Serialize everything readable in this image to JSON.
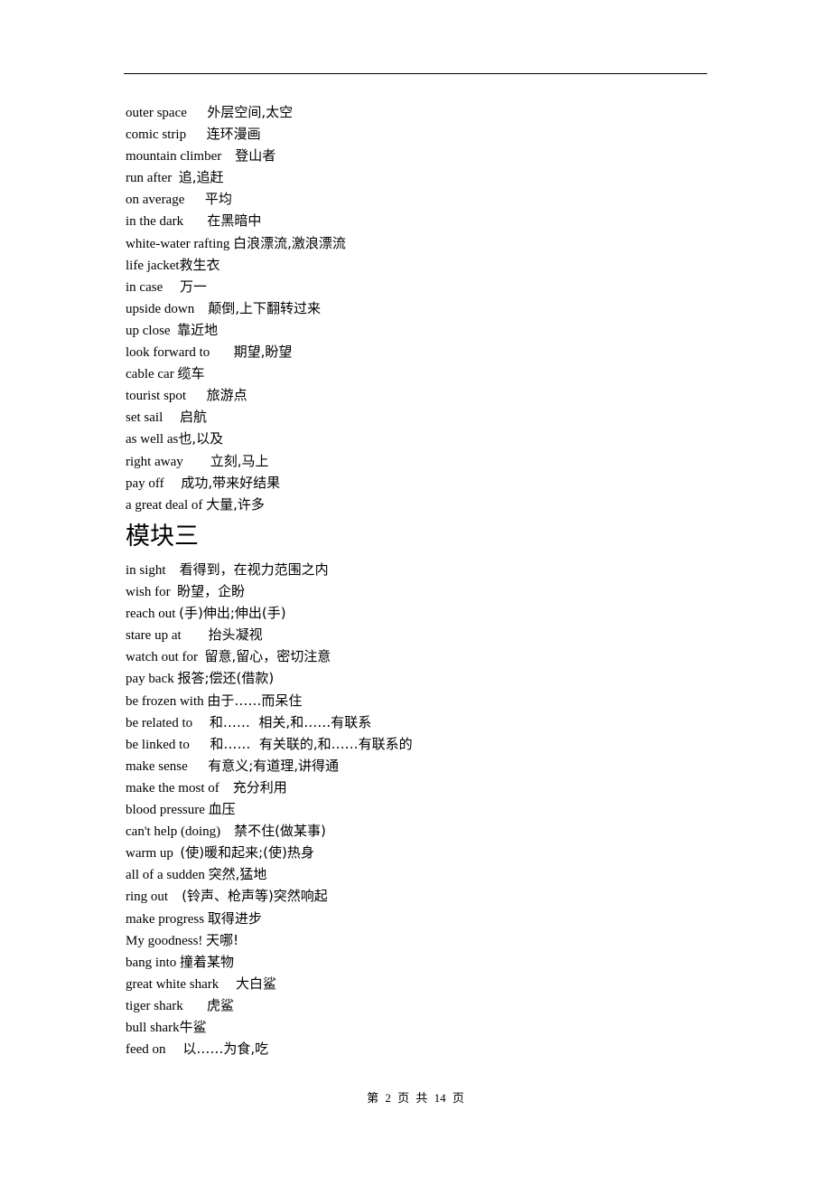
{
  "section_a": {
    "entries": [
      {
        "en": "outer space",
        "gap": "      ",
        "zh": "外层空间,太空"
      },
      {
        "en": "comic strip",
        "gap": "      ",
        "zh": "连环漫画"
      },
      {
        "en": "mountain climber",
        "gap": "    ",
        "zh": "登山者"
      },
      {
        "en": "run after",
        "gap": "  ",
        "zh": "追,追赶"
      },
      {
        "en": "on average",
        "gap": "      ",
        "zh": "平均"
      },
      {
        "en": "in the dark",
        "gap": "       ",
        "zh": "在黑暗中"
      },
      {
        "en": "white-water rafting",
        "gap": " ",
        "zh": "白浪漂流,激浪漂流"
      },
      {
        "en": "life jacket",
        "gap": "",
        "zh": "救生衣"
      },
      {
        "en": "in case",
        "gap": "     ",
        "zh": "万一"
      },
      {
        "en": "upside down",
        "gap": "    ",
        "zh": "颠倒,上下翻转过来"
      },
      {
        "en": "up close",
        "gap": "  ",
        "zh": "靠近地"
      },
      {
        "en": "look forward to",
        "gap": "       ",
        "zh": "期望,盼望"
      },
      {
        "en": "cable car",
        "gap": " ",
        "zh": "缆车"
      },
      {
        "en": "tourist spot",
        "gap": "      ",
        "zh": "旅游点"
      },
      {
        "en": "set sail",
        "gap": "     ",
        "zh": "启航"
      },
      {
        "en": "as well as",
        "gap": "",
        "zh": "也,以及"
      },
      {
        "en": "right away",
        "gap": "        ",
        "zh": "立刻,马上"
      },
      {
        "en": "pay off",
        "gap": "     ",
        "zh": "成功,带来好结果"
      },
      {
        "en": "a great deal of",
        "gap": " ",
        "zh": "大量,许多"
      }
    ]
  },
  "section_b": {
    "title": "模块三",
    "entries": [
      {
        "en": "in sight",
        "gap": "    ",
        "zh": "看得到，在视力范围之内"
      },
      {
        "en": "wish for",
        "gap": "  ",
        "zh": "盼望，企盼"
      },
      {
        "en": "reach out",
        "gap": " ",
        "zh": "(手)伸出;伸出(手)"
      },
      {
        "en": "stare up at",
        "gap": "        ",
        "zh": "抬头凝视"
      },
      {
        "en": "watch out for",
        "gap": "  ",
        "zh": "留意,留心，密切注意"
      },
      {
        "en": "pay back",
        "gap": " ",
        "zh": "报答;偿还(借款)"
      },
      {
        "en": "be frozen with",
        "gap": " ",
        "zh": "由于……而呆住"
      },
      {
        "en": "be related to",
        "gap": "     ",
        "zh": "和……  相关,和……有联系"
      },
      {
        "en": "be linked to",
        "gap": "      ",
        "zh": "和……  有关联的,和……有联系的"
      },
      {
        "en": "make sense",
        "gap": "      ",
        "zh": "有意义;有道理,讲得通"
      },
      {
        "en": "make the most of",
        "gap": "    ",
        "zh": "充分利用"
      },
      {
        "en": "blood pressure",
        "gap": " ",
        "zh": "血压"
      },
      {
        "en": "can't help (doing)",
        "gap": "    ",
        "zh": "禁不住(做某事)"
      },
      {
        "en": "warm up",
        "gap": "  ",
        "zh": "(使)暖和起来;(使)热身"
      },
      {
        "en": "all of a sudden",
        "gap": " ",
        "zh": "突然,猛地"
      },
      {
        "en": "ring out",
        "gap": "    ",
        "zh": "(铃声、枪声等)突然响起"
      },
      {
        "en": "make progress",
        "gap": " ",
        "zh": "取得进步"
      },
      {
        "en": "My goodness!",
        "gap": " ",
        "zh": "天哪!"
      },
      {
        "en": "bang into",
        "gap": " ",
        "zh": "撞着某物"
      },
      {
        "en": "great white shark",
        "gap": "     ",
        "zh": "大白鲨"
      },
      {
        "en": "tiger shark",
        "gap": "       ",
        "zh": "虎鲨"
      },
      {
        "en": "bull shark",
        "gap": "",
        "zh": "牛鲨"
      },
      {
        "en": "feed on",
        "gap": "     ",
        "zh": "以……为食,吃"
      }
    ]
  },
  "footer": {
    "page_label": "第 2 页 共 14 页"
  }
}
